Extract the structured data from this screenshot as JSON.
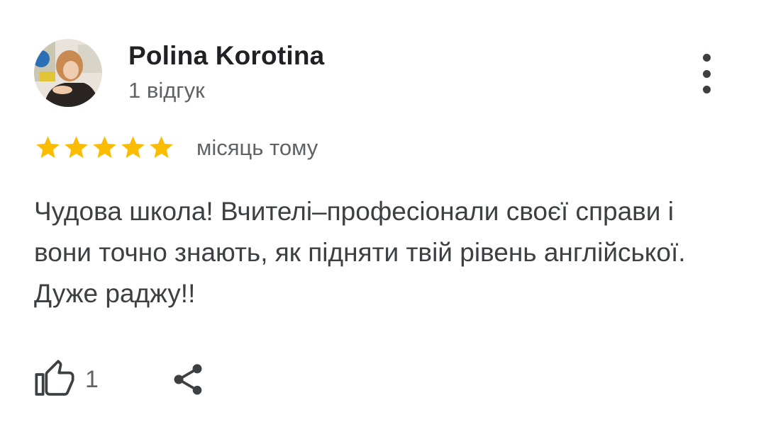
{
  "review": {
    "author_name": "Polina Korotina",
    "author_meta": "1 відгук",
    "avatar_icon": "user-avatar-photo",
    "rating": 5,
    "rating_max": 5,
    "star_color": "#fbbc04",
    "time_ago": "місяць тому",
    "text": "Чудова школа! Вчителі–професіонали своєї справи і вони точно знають, як підняти твій рівень англійської. Дуже раджу!!",
    "likes": "1"
  },
  "icons": {
    "more": "more-vert-icon",
    "like": "thumb-up-icon",
    "share": "share-icon"
  }
}
